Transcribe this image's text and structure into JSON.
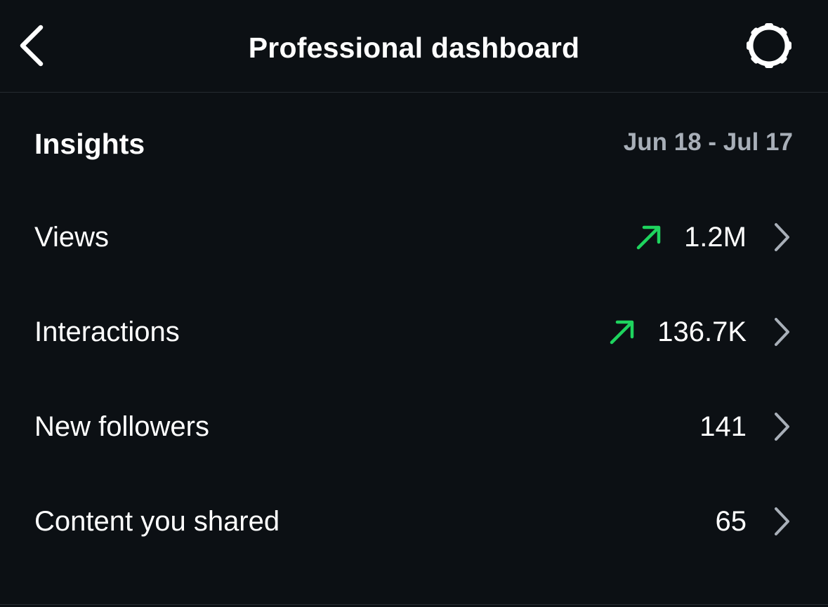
{
  "header": {
    "title": "Professional dashboard",
    "back_icon": "chevron-left-icon",
    "settings_icon": "gear-icon"
  },
  "insights": {
    "title": "Insights",
    "date_range": "Jun 18 - Jul 17",
    "rows": [
      {
        "label": "Views",
        "value": "1.2M",
        "trend": "up"
      },
      {
        "label": "Interactions",
        "value": "136.7K",
        "trend": "up"
      },
      {
        "label": "New followers",
        "value": "141",
        "trend": null
      },
      {
        "label": "Content you shared",
        "value": "65",
        "trend": null
      }
    ]
  },
  "colors": {
    "background": "#0c1014",
    "divider": "#262b31",
    "text_primary": "#ffffff",
    "text_secondary": "#a8afb8",
    "trend_up": "#1ed45e",
    "chevron": "#a8afb8"
  }
}
